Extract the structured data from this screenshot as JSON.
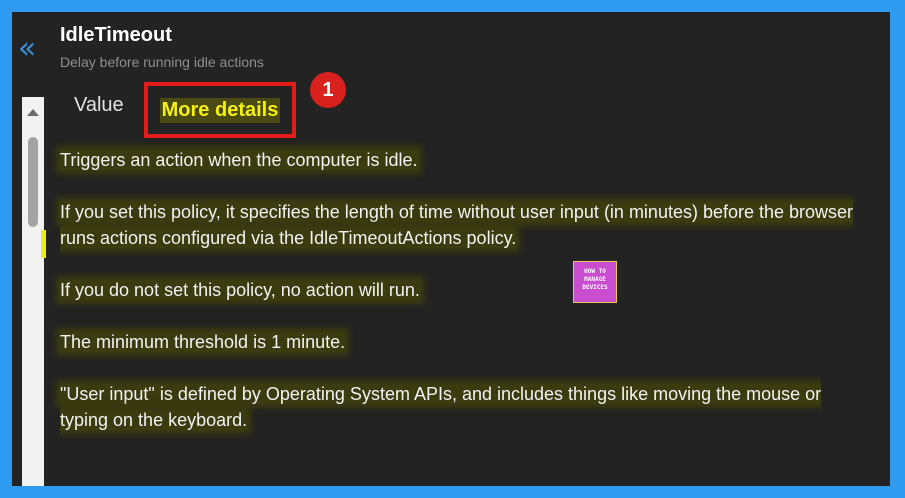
{
  "header": {
    "back_icon": "chevron-double-left-icon",
    "title": "IdleTimeout",
    "subtitle": "Delay before running idle actions"
  },
  "tabs": [
    {
      "label": "Value",
      "selected": false
    },
    {
      "label": "More details",
      "selected": true
    }
  ],
  "annotation": {
    "badge_number": "1"
  },
  "paragraphs": [
    "Triggers an action when the computer is idle.",
    "If you set this policy, it specifies the length of time without user input (in minutes) before the browser runs actions configured via the IdleTimeoutActions policy.",
    "If you do not set this policy, no action will run.",
    "The minimum threshold is 1 minute.",
    "\"User input\" is defined by Operating System APIs, and includes things like moving the mouse or typing on the keyboard."
  ],
  "watermark": {
    "line1": "HOW TO",
    "line2": "MANAGE",
    "line3": "DEVICES"
  },
  "colors": {
    "frame": "#2e9bf0",
    "panel": "#232323",
    "accent_blue": "#3a8fd8",
    "highlight_yellow": "#f6ef12",
    "callout_red": "#e21b1b"
  }
}
